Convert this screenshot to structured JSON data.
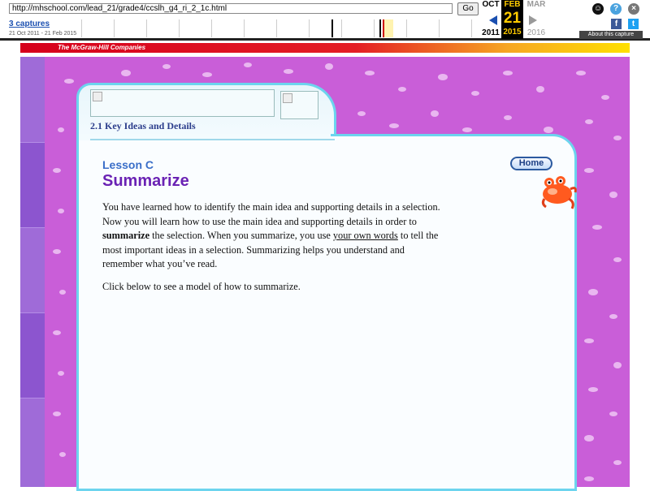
{
  "wayback": {
    "url": "http://mhschool.com/lead_21/grade4/ccslh_g4_ri_2_1c.html",
    "go_label": "Go",
    "captures_label": "3 captures",
    "date_range": "21 Oct 2011 - 21 Feb 2015",
    "prev_month": "OCT",
    "prev_year": "2011",
    "current_month": "FEB",
    "current_day": "21",
    "current_year": "2015",
    "next_month": "MAR",
    "next_year": "2016",
    "about_label": "About this capture"
  },
  "header": {
    "brand": "The McGraw-Hill Companies"
  },
  "lesson": {
    "breadcrumb": "2.1 Key Ideas and Details",
    "label": "Lesson C",
    "title": "Summarize",
    "para1_a": "You have learned how to identify the main idea and supporting details in a selection. Now you will learn how to use the main idea and supporting details in order to ",
    "para1_bold": "summarize",
    "para1_b": " the selection. When you summarize, you use ",
    "para1_link": "your own words",
    "para1_c": " to tell the most important ideas in a selection. Summarizing helps you understand and remember what you’ve read.",
    "para2": "Click below to see a model of how to summarize.",
    "home_button": "Home"
  },
  "colors": {
    "background": "#c95ed8",
    "panel_border": "#6cd4ee",
    "title": "#6a22b4",
    "lesson_label": "#3a6ec8"
  }
}
